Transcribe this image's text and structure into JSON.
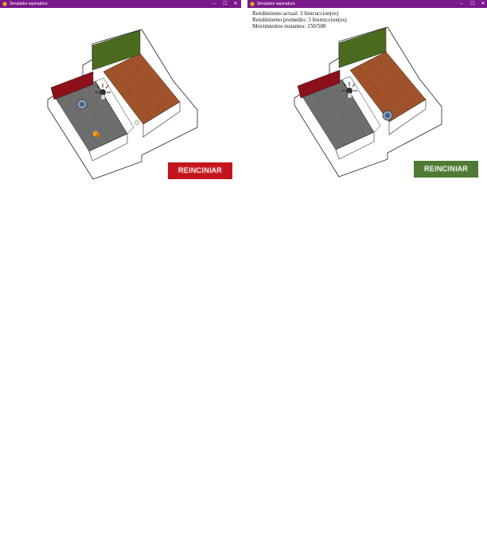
{
  "window_left": {
    "title": "Simulador aspiradora",
    "reset_label": "REINCINIAR",
    "reset_color": "#c4131b"
  },
  "window_right": {
    "title": "Simulador aspiradora",
    "reset_label": "REINCINIAR",
    "reset_color": "#4e7a33",
    "stats": {
      "current": "Rendimiento actual: 3 Instruccion(es)",
      "average": "Rendimiento promedio: 3 Instruccion(es)",
      "moves": "Movimientos restantes: 150/500"
    }
  },
  "controls": {
    "minimize": "–",
    "maximize": "☐",
    "close": "✕"
  },
  "colors": {
    "titlebar": "#7a1a8c",
    "floor_tile": "#6e6e6e",
    "floor_wood": "#a0532a",
    "wall_red": "#8b1019",
    "wall_green": "#4a6b1e"
  },
  "icons": [
    "app-icon",
    "vacuum-robot-icon",
    "dirt-icon",
    "plant-icon"
  ]
}
